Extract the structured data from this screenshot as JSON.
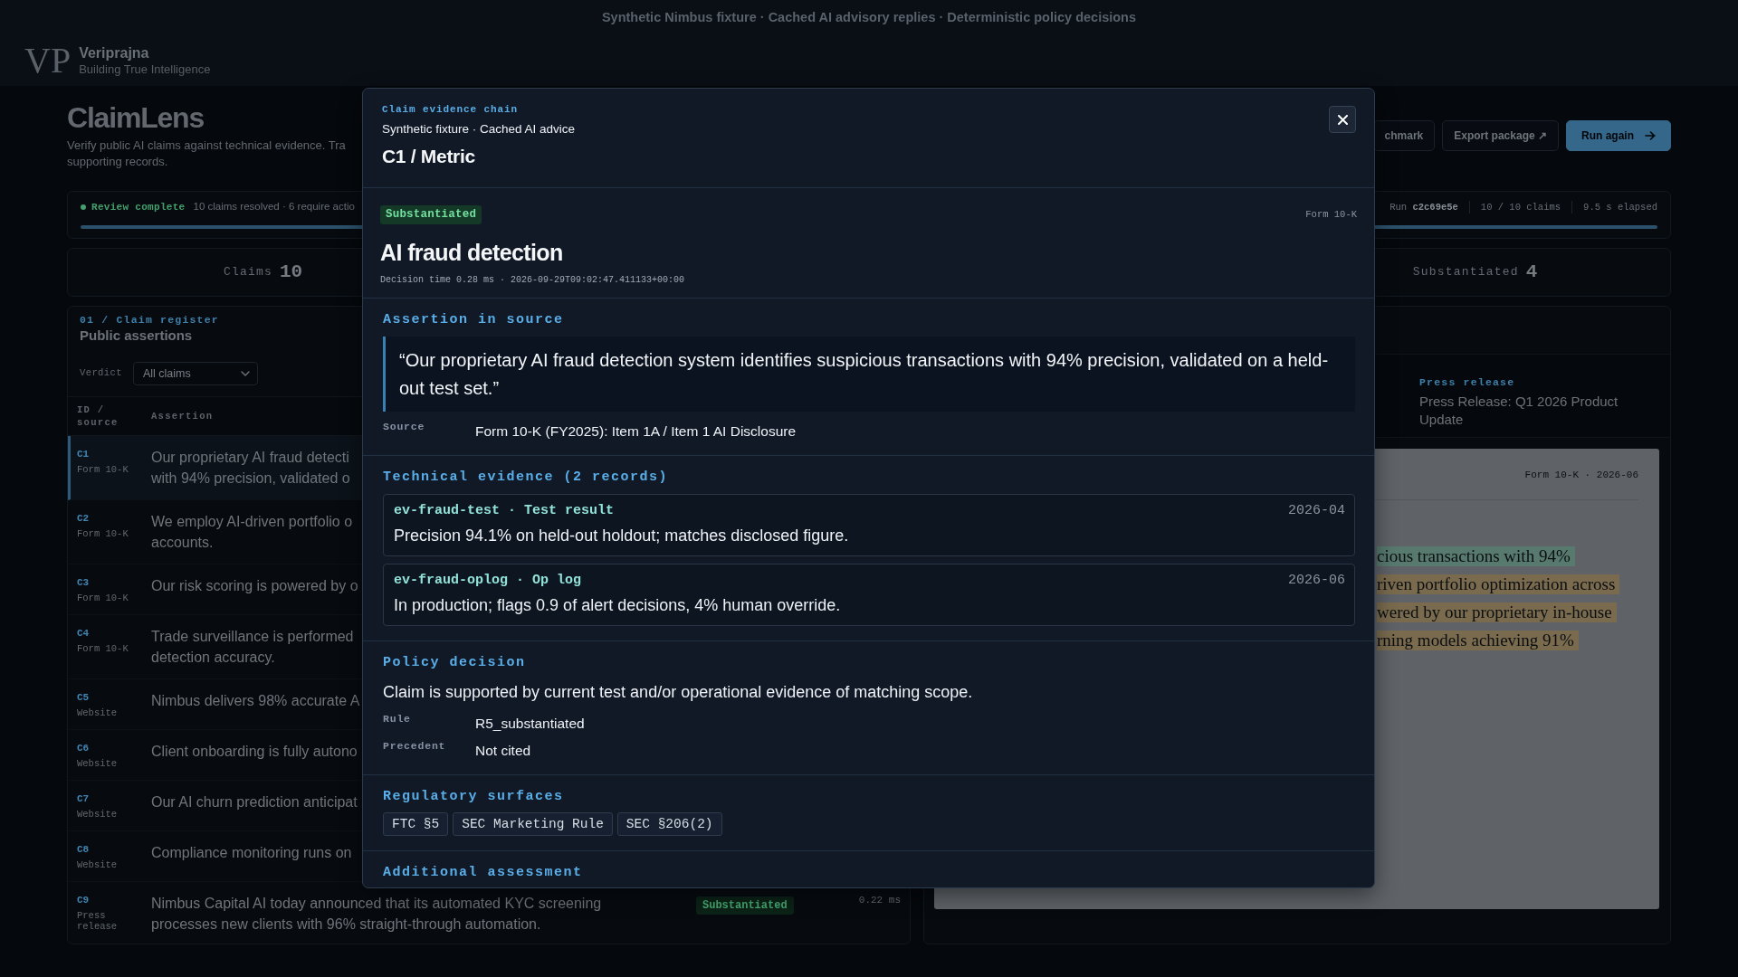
{
  "banner": {
    "text": "Synthetic Nimbus fixture · Cached AI advisory replies · Deterministic policy decisions"
  },
  "brand": {
    "logo": "VP",
    "name": "Veriprajna",
    "tagline": "Building True Intelligence"
  },
  "page_header": {
    "title": "ClaimLens",
    "subtitle_lines": [
      "Verify public AI claims against technical evidence. Tra",
      "supporting records."
    ],
    "buttons": [
      {
        "label": "chmark",
        "kind": "secondary"
      },
      {
        "label": "Export package ↗",
        "kind": "secondary"
      },
      {
        "label": "Run again",
        "kind": "primary"
      }
    ]
  },
  "status": {
    "label": "Review complete",
    "summary": "10 claims resolved · 6 require actio",
    "meta": [
      "Run **c2c69e5e**",
      "10 / 10 claims",
      "9.5 s elapsed"
    ],
    "progress": {
      "level": 1
    }
  },
  "stats": [
    {
      "label": "Claims",
      "value": "10"
    },
    {
      "label": "Substantiated",
      "value": "4"
    }
  ],
  "claim_register": {
    "kicker": "01 / Claim register",
    "title": "Public assertions",
    "filter": {
      "label": "Verdict",
      "value": "All claims"
    },
    "columns": [
      "ID / source",
      "Assertion"
    ],
    "rows": [
      {
        "id": "C1",
        "source": "Form 10-K",
        "lines": [
          "Our proprietary AI fraud detecti",
          "with 94% precision, validated o"
        ],
        "selected": true
      },
      {
        "id": "C2",
        "source": "Form 10-K",
        "lines": [
          "We employ AI-driven portfolio o",
          "accounts."
        ],
        "selected": false
      },
      {
        "id": "C3",
        "source": "Form 10-K",
        "lines": [
          "Our risk scoring is powered by o"
        ],
        "selected": false
      },
      {
        "id": "C4",
        "source": "Form 10-K",
        "lines": [
          "Trade surveillance is performed",
          "detection accuracy."
        ],
        "selected": false
      },
      {
        "id": "C5",
        "source": "Website",
        "lines": [
          "Nimbus delivers 98% accurate A"
        ],
        "selected": false
      },
      {
        "id": "C6",
        "source": "Website",
        "lines": [
          "Client onboarding is fully autono"
        ],
        "selected": false
      },
      {
        "id": "C7",
        "source": "Website",
        "lines": [
          "Our AI churn prediction anticipat"
        ],
        "selected": false
      },
      {
        "id": "C8",
        "source": "Website",
        "lines": [
          "Compliance monitoring runs on"
        ],
        "selected": false
      },
      {
        "id": "C9",
        "source": "Press release",
        "lines": [
          "Nimbus Capital AI today announced that its automated KYC screening",
          "processes new clients with 96% straight-through automation."
        ],
        "verdict": "Substantiated",
        "time": "0.22 ms",
        "selected": false
      }
    ]
  },
  "source_panel": {
    "tab": {
      "kicker": "Press release",
      "title": "Press Release: Q1 2026 Product Update"
    },
    "document": {
      "meta": "Form 10-K · 2026-06",
      "lines": [
        {
          "text": "cious transactions with 94%",
          "color": "#587a6e"
        },
        {
          "text": "riven portfolio optimization across",
          "color": "#7a6b4e"
        },
        {
          "text": "wered by our proprietary in-house",
          "color": "#7a6b4e"
        },
        {
          "text": "rning models achieving 91%",
          "color": "#7a6b4e"
        }
      ]
    }
  },
  "evidence_dialog": {
    "kicker": "Claim evidence chain",
    "subtitle": "Synthetic fixture · Cached AI advice",
    "title": "C1 / Metric",
    "claim": {
      "verdict": "Substantiated",
      "source_form": "Form 10-K",
      "title": "AI fraud detection",
      "decision_meta": "Decision time 0.28 ms · 2026-09-29T09:02:47.411133+00:00"
    },
    "sections": [
      {
        "kind": "assertion",
        "heading": "Assertion in source",
        "quote": "“Our proprietary AI fraud detection system identifies suspicious transactions with 94% precision, validated on a held-out test set.”",
        "fields": [
          {
            "label": "Source",
            "value": "Form 10-K (FY2025): Item 1A / Item 1 AI Disclosure"
          }
        ]
      },
      {
        "kind": "evidence",
        "heading": "Technical evidence (2 records)",
        "records": [
          {
            "title": "ev-fraud-test · Test result",
            "date": "2026-04",
            "text": "Precision 94.1% on held-out holdout; matches disclosed figure."
          },
          {
            "title": "ev-fraud-oplog · Op log",
            "date": "2026-06",
            "text": "In production; flags 0.9 of alert decisions, 4% human override."
          }
        ]
      },
      {
        "kind": "policy",
        "heading": "Policy decision",
        "text": "Claim is supported by current test and/or operational evidence of matching scope.",
        "fields": [
          {
            "label": "Rule",
            "value": "R5_substantiated"
          },
          {
            "label": "Precedent",
            "value": "Not cited"
          }
        ]
      },
      {
        "kind": "tags",
        "heading": "Regulatory surfaces",
        "tags": [
          "FTC §5",
          "SEC Marketing Rule",
          "SEC §206(2)"
        ]
      },
      {
        "kind": "assessment",
        "heading": "Additional assessment"
      }
    ]
  }
}
